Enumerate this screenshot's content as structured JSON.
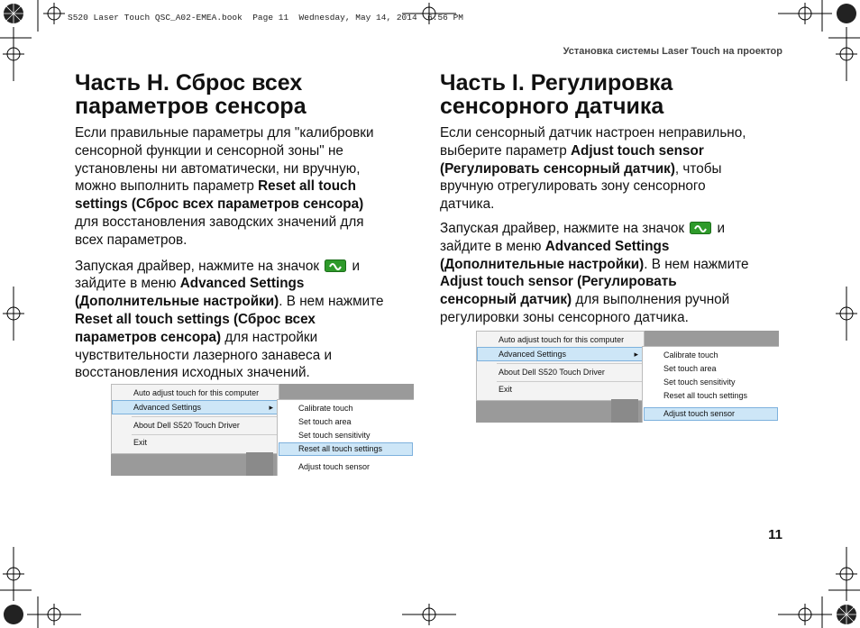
{
  "print_line": "S520 Laser Touch QSC_A02-EMEA.book  Page 11  Wednesday, May 14, 2014  6:56 PM",
  "running_head": "Установка системы Laser Touch на проектор",
  "page_number": "11",
  "left": {
    "heading_line1": "Часть H. Сброс всех",
    "heading_line2": "параметров сенсора",
    "p1_lines": [
      "Если правильные параметры для \"калибровки",
      "сенсорной функции и сенсорной зоны\" не",
      "установлены ни автоматически, ни вручную,"
    ],
    "p1_l4_pre": "можно выполнить параметр ",
    "p1_l4_bold": "Reset all touch",
    "p1_l5_bold": "settings (Сброс всех параметров сенсора)",
    "p1_l6": "для восстановления заводских значений для",
    "p1_l7": "всех параметров.",
    "p2_l1_pre": "Запуская драйвер, нажмите на значок",
    "p2_l1_post": "и",
    "p2_l2_pre": "зайдите в меню ",
    "p2_l2_bold": "Advanced Settings",
    "p2_l3_bold": "(Дополнительные настройки)",
    "p2_l3_post": ". В нем нажмите",
    "p2_l4_bold": "Reset all touch settings (Сброс всех",
    "p2_l5_bold": "параметров сенсора)",
    "p2_l5_post": " для настройки",
    "p2_l6": "чувствительности лазерного занавеса и",
    "p2_l7": "восстановления исходных значений."
  },
  "right": {
    "heading_line1": "Часть I. Регулировка",
    "heading_line2": "сенсорного датчика",
    "p1_l1": "Если сенсорный датчик настроен неправильно,",
    "p1_l2_pre": "выберите параметр ",
    "p1_l2_bold": "Adjust touch sensor",
    "p1_l3_bold": "(Регулировать сенсорный датчик)",
    "p1_l3_post": ", чтобы",
    "p1_l4": "вручную отрегулировать зону сенсорного",
    "p1_l5": "датчика.",
    "p2_l1_pre": "Запуская драйвер, нажмите на значок",
    "p2_l1_post": "и",
    "p2_l2_pre": "зайдите в меню ",
    "p2_l2_bold": "Advanced Settings",
    "p2_l3_bold": "(Дополнительные настройки)",
    "p2_l3_post": ". В нем нажмите",
    "p2_l4_bold": "Adjust touch sensor (Регулировать",
    "p2_l5_bold": "сенсорный датчик)",
    "p2_l5_post": " для выполнения ручной",
    "p2_l6": "регулировки зоны сенсорного датчика."
  },
  "menu": {
    "items": [
      "Auto adjust touch for this computer",
      "Advanced Settings",
      "About Dell S520 Touch Driver",
      "Exit"
    ],
    "submenu": [
      "Calibrate touch",
      "Set touch area",
      "Set touch sensitivity",
      "Reset all touch settings",
      "Adjust touch sensor"
    ]
  },
  "colors": {
    "icon_green": "#2e9a2a",
    "highlight": "#cde6f7"
  }
}
